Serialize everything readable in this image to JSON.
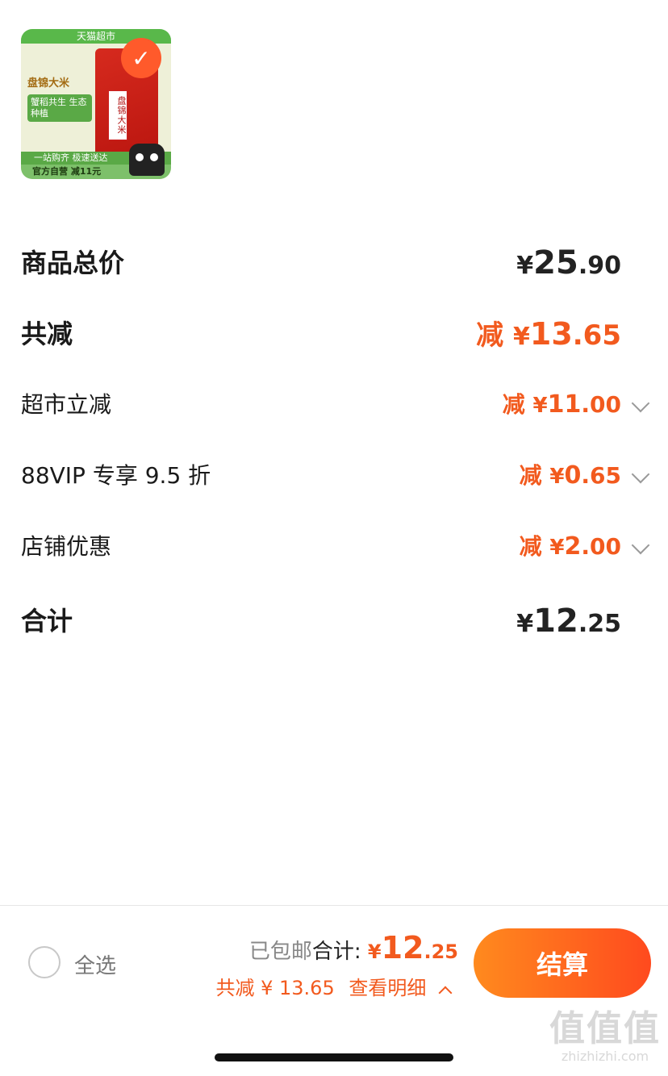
{
  "product": {
    "thumb_top_banner": "天猫超市",
    "brand": "盘锦大米",
    "tag": "蟹稻共生 生态种植",
    "bag_label": "盘锦大米",
    "bottom_band_1": "一站购齐 极速送达",
    "bottom_band_2": "官方自营 减11元",
    "selected": true
  },
  "rows": {
    "goods_total": {
      "label": "商品总价",
      "yen": "¥",
      "int": "25",
      "dec": ".90"
    },
    "total_discount": {
      "label": "共减",
      "prefix": "减 ",
      "yen": "¥",
      "int": "13",
      "dec": ".65"
    },
    "supermarket_discount": {
      "label": "超市立减",
      "prefix": "减 ",
      "yen": "¥",
      "int": "11",
      "dec": ".00"
    },
    "vip_discount": {
      "label": "88VIP 专享 9.5 折",
      "prefix": "减 ",
      "yen": "¥",
      "int": "0",
      "dec": ".65"
    },
    "store_discount": {
      "label": "店铺优惠",
      "prefix": "减 ",
      "yen": "¥",
      "int": "2",
      "dec": ".00"
    },
    "total": {
      "label": "合计",
      "yen": "¥",
      "int": "12",
      "dec": ".25"
    }
  },
  "bottom_bar": {
    "select_all": "全选",
    "shipping": "已包邮",
    "total_label": "合计:",
    "yen": "¥",
    "total_int": "12",
    "total_dec": ".25",
    "discount_summary": "共减 ¥ 13.65",
    "view_details": "查看明细",
    "checkout": "结算"
  },
  "watermark": {
    "text": "值值值",
    "url": "zhizhizhi.com"
  },
  "colors": {
    "accent": "#f25a1e",
    "text": "#222222",
    "muted": "#888888"
  }
}
